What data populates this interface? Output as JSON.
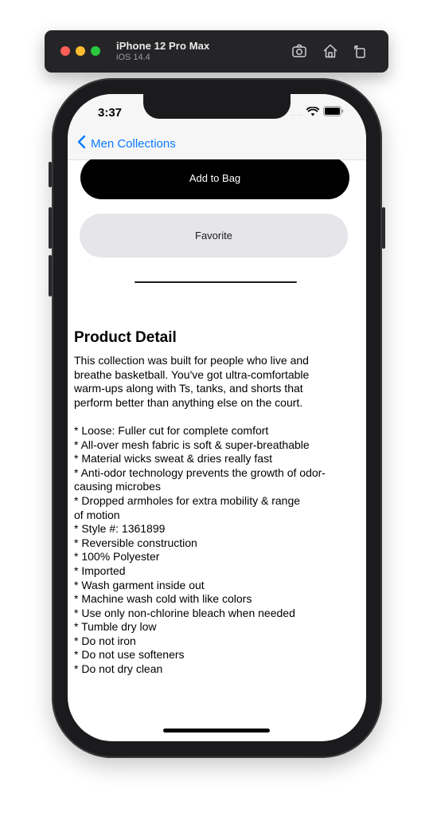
{
  "simulator": {
    "device_name": "iPhone 12 Pro Max",
    "os_version": "iOS 14.4",
    "controls": [
      "screenshot-icon",
      "home-icon",
      "rotate-icon"
    ]
  },
  "status_bar": {
    "time": "3:37",
    "signal": "....",
    "icons": [
      "wifi-icon",
      "battery-icon"
    ]
  },
  "nav": {
    "back_label": "Men Collections",
    "back_icon": "chevron-left-icon",
    "tint_color": "#0a7aff"
  },
  "actions": {
    "add_to_bag": "Add to Bag",
    "favorite": "Favorite"
  },
  "product_detail": {
    "title": "Product Detail",
    "body": "This collection was built for people who live and\nbreathe basketball. You've got ultra-comfortable\nwarm-ups along with Ts, tanks, and shorts that\nperform better than anything else on the court.\n\n* Loose: Fuller cut for complete comfort\n* All-over mesh fabric is soft & super-breathable\n* Material wicks sweat & dries really fast\n* Anti-odor technology prevents the growth of odor-\ncausing microbes\n* Dropped armholes for extra mobility & range\nof motion\n* Style #: 1361899\n* Reversible construction\n* 100% Polyester\n* Imported\n* Wash garment inside out\n* Machine wash cold with like colors\n* Use only non-chlorine bleach when needed\n* Tumble dry low\n* Do not iron\n* Do not use softeners\n* Do not dry clean"
  }
}
